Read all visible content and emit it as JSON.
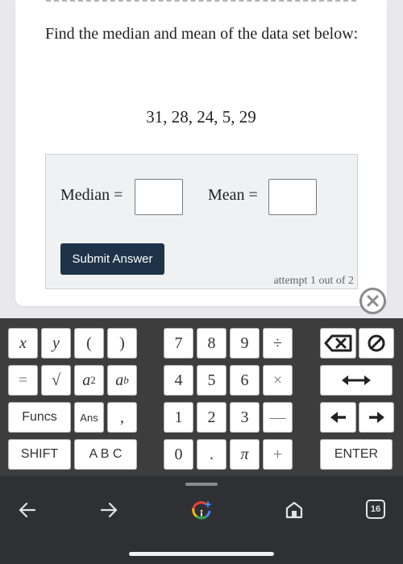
{
  "question": {
    "prompt": "Find the median and mean of the data set below:",
    "dataset": "31, 28, 24, 5, 29"
  },
  "answer": {
    "median_label": "Median =",
    "median_value": "",
    "mean_label": "Mean =",
    "mean_value": "",
    "submit_label": "Submit Answer",
    "attempt_text": "attempt 1 out of 2"
  },
  "keypad": {
    "row1": {
      "x": "x",
      "y": "y",
      "lparen": "(",
      "rparen": ")",
      "k7": "7",
      "k8": "8",
      "k9": "9",
      "div": "÷"
    },
    "row2": {
      "eq": "=",
      "sqrt": "√",
      "a_base": "a",
      "a_sq_exp": "2",
      "a_pow_exp": "b",
      "k4": "4",
      "k5": "5",
      "k6": "6",
      "mul": "×"
    },
    "row3": {
      "funcs": "Funcs",
      "ans": "Ans",
      "comma": ",",
      "k1": "1",
      "k2": "2",
      "k3": "3",
      "minus": "—"
    },
    "row4": {
      "shift": "SHIFT",
      "abc": "A B C",
      "k0": "0",
      "dot": ".",
      "pi": "π",
      "plus": "+",
      "enter": "ENTER"
    }
  },
  "navbar": {
    "tab_count": "16"
  },
  "colors": {
    "submit_bg": "#1e3348",
    "keypad_bg": "#3d3d3d",
    "navbar_bg": "#2f3033"
  }
}
